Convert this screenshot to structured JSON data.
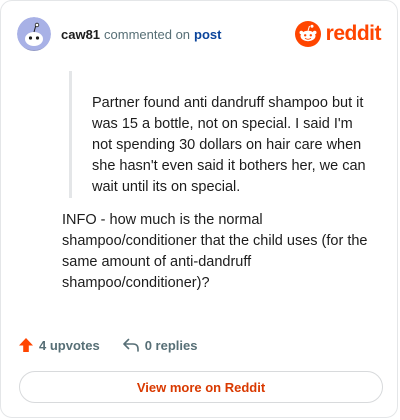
{
  "header": {
    "username": "caw81",
    "action_text": "commented on",
    "post_link": "post",
    "brand": "reddit",
    "colors": {
      "brand": "#ff4500",
      "link": "#0a449b",
      "button_text": "#d93900"
    }
  },
  "quote": {
    "text": "Partner found anti dandruff shampoo but it was 15 a bottle, not on special. I said I'm not spending 30 dollars on hair care when she hasn't even said it bothers her, we can wait until its on special."
  },
  "comment": {
    "text": "INFO - how much is the normal shampoo/conditioner that the child uses (for the same amount of anti-dandruff shampoo/conditioner)?"
  },
  "actions": {
    "upvotes": "4 upvotes",
    "replies": "0 replies"
  },
  "footer": {
    "view_more": "View more on Reddit"
  }
}
